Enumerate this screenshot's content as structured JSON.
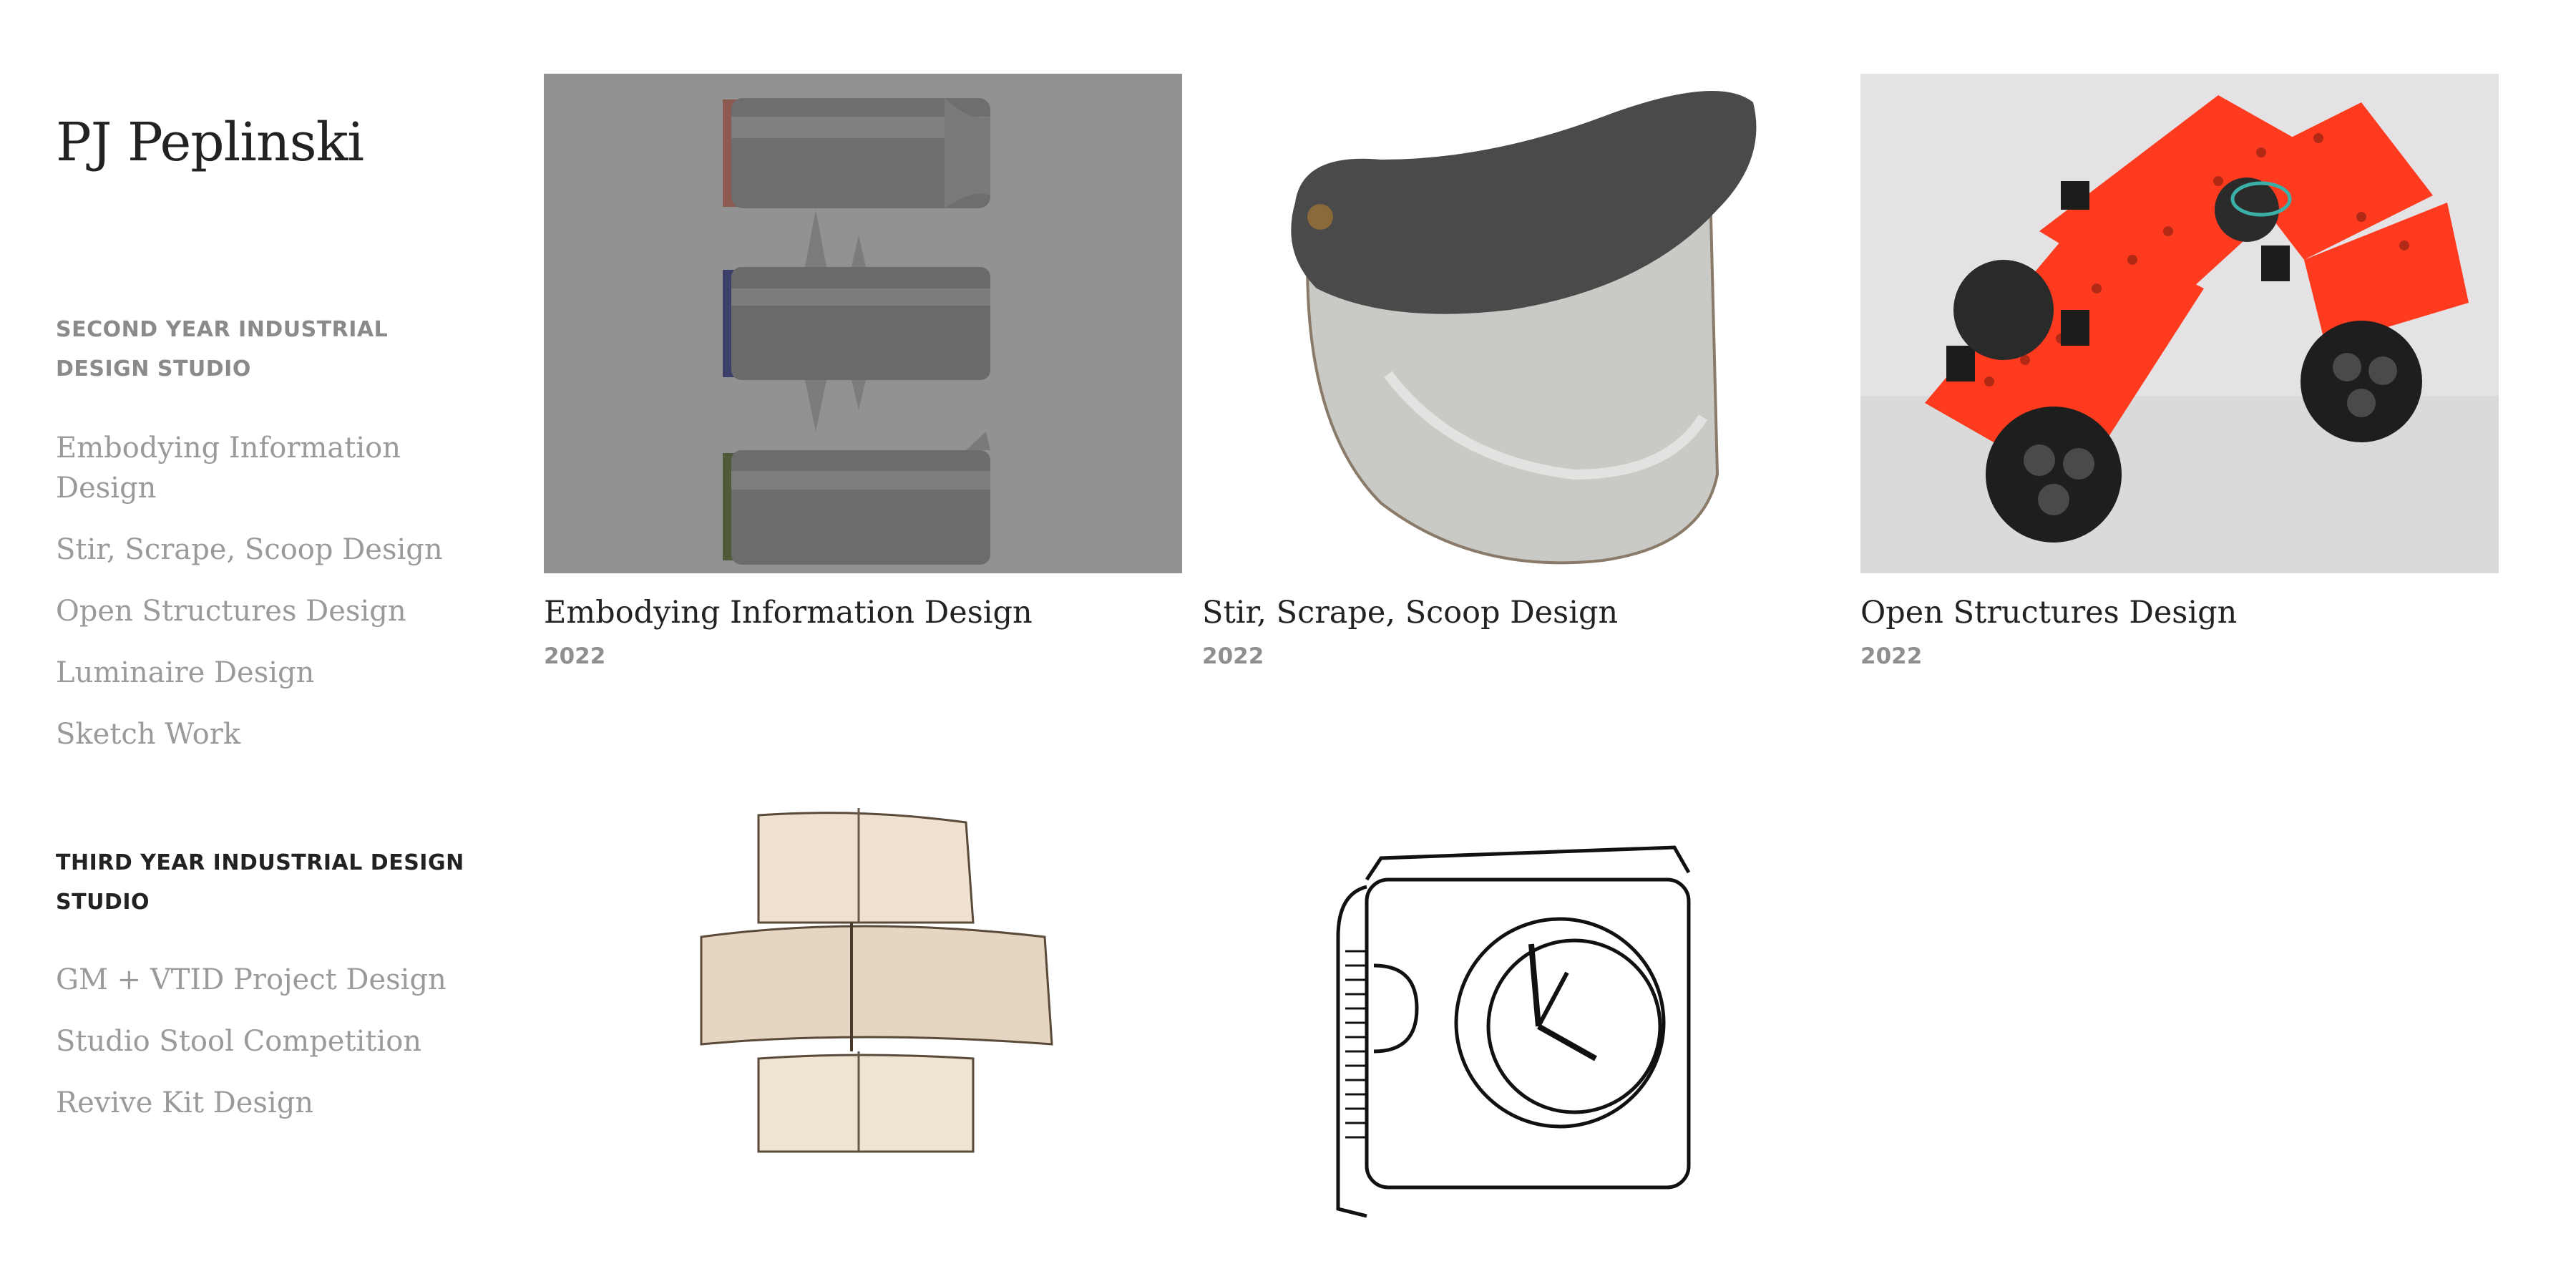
{
  "site": {
    "title": "PJ Peplinski"
  },
  "sidebar": {
    "sections": [
      {
        "heading": "SECOND YEAR INDUSTRIAL DESIGN STUDIO",
        "items": [
          {
            "label": "Embodying Information Design"
          },
          {
            "label": "Stir, Scrape, Scoop Design"
          },
          {
            "label": "Open Structures Design"
          },
          {
            "label": "Luminaire Design"
          },
          {
            "label": "Sketch Work"
          }
        ]
      },
      {
        "heading": "THIRD YEAR INDUSTRIAL DESIGN STUDIO",
        "items": [
          {
            "label": "GM + VTID Project Design"
          },
          {
            "label": "Studio Stool Competition"
          },
          {
            "label": "Revive Kit Design"
          }
        ]
      }
    ]
  },
  "gallery": {
    "projects": [
      {
        "title": "Embodying Information Design",
        "year": "2022",
        "image": "three-grey-cylinders-render"
      },
      {
        "title": "Stir, Scrape, Scoop Design",
        "year": "2022",
        "image": "scoop-tool-photo"
      },
      {
        "title": "Open Structures Design",
        "year": "2022",
        "image": "red-wheeled-structure-photo"
      },
      {
        "title": "Luminaire Design",
        "year": "",
        "image": "paper-lamp-photo"
      },
      {
        "title": "Sketch Work",
        "year": "",
        "image": "clock-box-sketch"
      }
    ]
  },
  "colors": {
    "accent": "#ff3b1f",
    "muted_text": "#9a9a9a",
    "heading_muted": "#8a8a8a",
    "text": "#222222",
    "render_bg": "#929292"
  }
}
